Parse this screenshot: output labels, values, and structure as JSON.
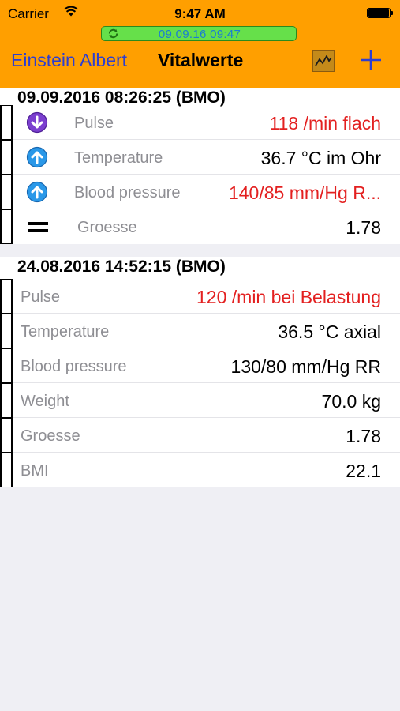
{
  "status_bar": {
    "carrier": "Carrier",
    "time": "9:47 AM"
  },
  "sync": {
    "text": "09.09.16 09:47"
  },
  "nav": {
    "patient": "Einstein Albert",
    "title": "Vitalwerte"
  },
  "colors": {
    "accent": "#ff9f00",
    "alert": "#e32020",
    "link": "#2d3ed0"
  },
  "entries": [
    {
      "header": "09.09.2016 08:26:25 (BMO)",
      "rows": [
        {
          "icon": "arrow-down-purple-icon",
          "label": "Pulse",
          "value": "118 /min flach",
          "alert": true
        },
        {
          "icon": "arrow-up-blue-icon",
          "label": "Temperature",
          "value": "36.7 °C im Ohr",
          "alert": false
        },
        {
          "icon": "arrow-up-blue-icon",
          "label": "Blood pressure",
          "value": "140/85 mm/Hg R...",
          "alert": true
        },
        {
          "icon": "equal-icon",
          "label": "Groesse",
          "value": "1.78",
          "alert": false
        }
      ]
    },
    {
      "header": "24.08.2016 14:52:15 (BMO)",
      "rows": [
        {
          "label": "Pulse",
          "value": "120 /min bei Belastung",
          "alert": true
        },
        {
          "label": "Temperature",
          "value": "36.5 °C axial",
          "alert": false
        },
        {
          "label": "Blood pressure",
          "value": "130/80 mm/Hg RR",
          "alert": false
        },
        {
          "label": "Weight",
          "value": "70.0 kg",
          "alert": false
        },
        {
          "label": "Groesse",
          "value": "1.78",
          "alert": false
        },
        {
          "label": "BMI",
          "value": "22.1",
          "alert": false
        }
      ]
    }
  ]
}
